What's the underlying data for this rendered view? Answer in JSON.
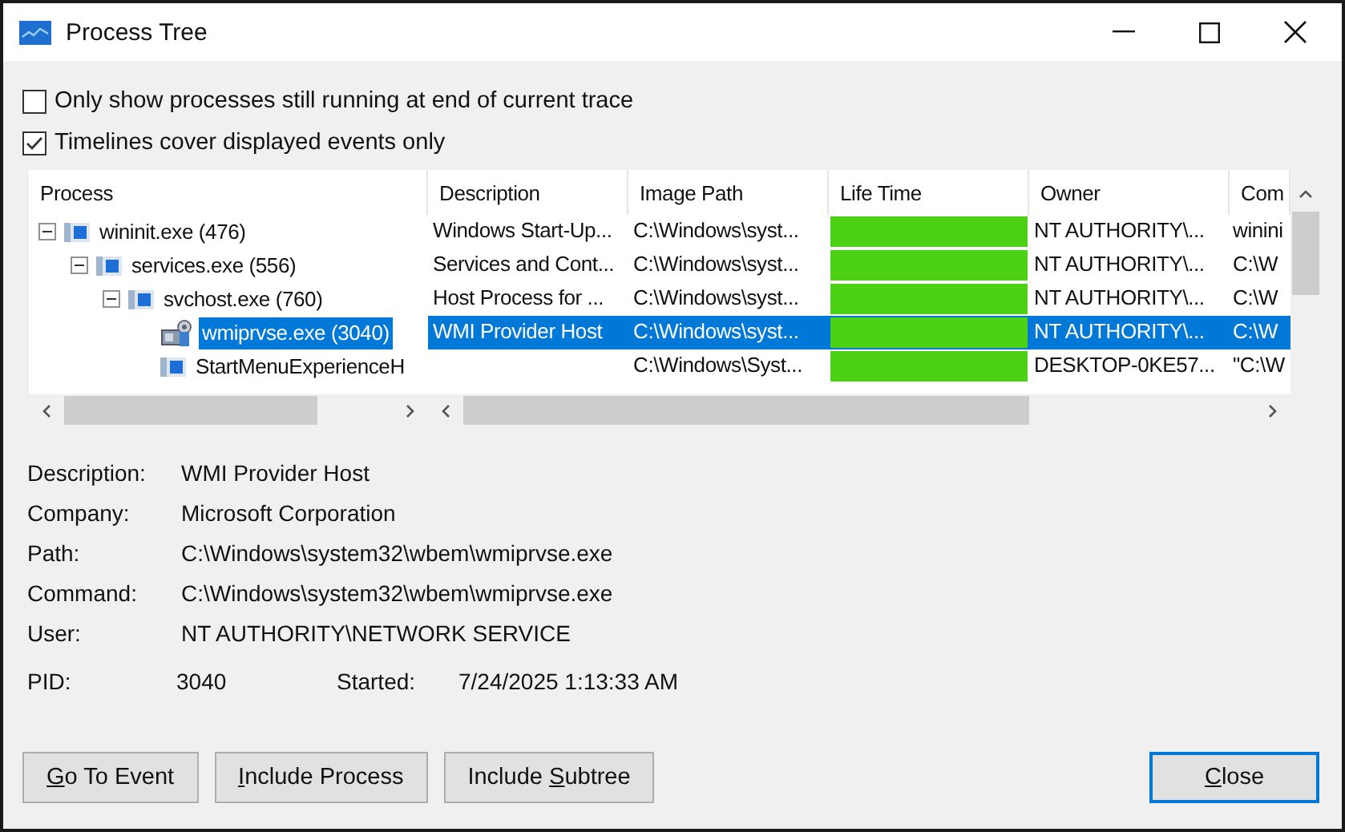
{
  "window": {
    "title": "Process Tree"
  },
  "options": [
    {
      "label": "Only show processes still running at end of current trace",
      "checked": false
    },
    {
      "label": "Timelines cover displayed events only",
      "checked": true
    }
  ],
  "tree": {
    "process_header": "Process",
    "columns": [
      "Description",
      "Image Path",
      "Life Time",
      "Owner",
      "Com"
    ],
    "processes": [
      {
        "name": "wininit.exe (476)",
        "kind": "window",
        "expanded": true,
        "selected": false,
        "description": "Windows Start-Up...",
        "image_path": "C:\\Windows\\syst...",
        "lifetime": {
          "level": 1
        },
        "owner": "NT AUTHORITY\\...",
        "command": "winini",
        "children": [
          {
            "name": "services.exe (556)",
            "kind": "window",
            "expanded": true,
            "selected": false,
            "description": "Services and Cont...",
            "image_path": "C:\\Windows\\syst...",
            "lifetime": {
              "level": 1
            },
            "owner": "NT AUTHORITY\\...",
            "command": "C:\\W",
            "children": [
              {
                "name": "svchost.exe (760)",
                "kind": "window",
                "expanded": true,
                "selected": false,
                "description": "Host Process for ...",
                "image_path": "C:\\Windows\\syst...",
                "lifetime": {
                  "level": 1
                },
                "owner": "NT AUTHORITY\\...",
                "command": "C:\\W",
                "children": [
                  {
                    "name": "wmiprvse.exe (3040)",
                    "kind": "service",
                    "selected": true,
                    "description": "WMI Provider Host",
                    "image_path": "C:\\Windows\\syst...",
                    "lifetime": {
                      "level": 1
                    },
                    "owner": "NT AUTHORITY\\...",
                    "command": "C:\\W"
                  },
                  {
                    "name": "StartMenuExperienceH",
                    "kind": "window",
                    "selected": false,
                    "image_path": "C:\\Windows\\Syst...",
                    "lifetime": {
                      "level": 1
                    },
                    "owner": "DESKTOP-0KE57...",
                    "command": "\"C:\\W"
                  }
                ]
              }
            ]
          }
        ]
      }
    ]
  },
  "details": [
    {
      "label": "Description:",
      "value": "WMI Provider Host"
    },
    {
      "label": "Company:",
      "value": "Microsoft Corporation"
    },
    {
      "label": "Path:",
      "value": "C:\\Windows\\system32\\wbem\\wmiprvse.exe"
    },
    {
      "label": "Command:",
      "value": "C:\\Windows\\system32\\wbem\\wmiprvse.exe"
    },
    {
      "label": "User:",
      "value": "NT AUTHORITY\\NETWORK SERVICE"
    }
  ],
  "pid": {
    "label": "PID:",
    "value": "3040",
    "started_label": "Started:",
    "started": "7/24/2025 1:13:33 AM"
  },
  "buttons": [
    {
      "key": "G",
      "after": "o To Event",
      "default": false
    },
    {
      "key": "I",
      "after": "nclude Process",
      "default": false
    },
    {
      "before": "Include ",
      "key": "S",
      "after": "ubtree",
      "default": false
    },
    {
      "key": "C",
      "after": "lose",
      "default": true
    }
  ]
}
